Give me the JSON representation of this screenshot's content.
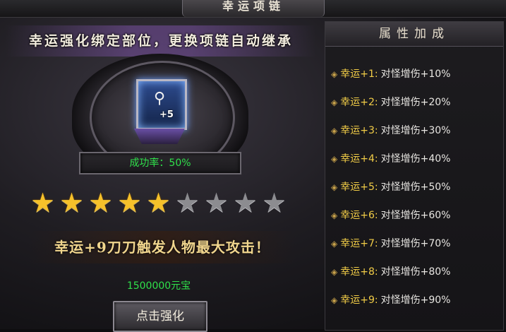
{
  "window": {
    "title": "幸运项链"
  },
  "banner": "幸运强化绑定部位，更换项链自动继承",
  "item": {
    "icon": "necklace-icon",
    "level_badge": "+5"
  },
  "success_rate": "成功率：50%",
  "stars": {
    "total": 9,
    "lit": 5
  },
  "tip": "幸运+9刀刀触发人物最大攻击！",
  "cost": "1500000元宝",
  "button": {
    "label": "点击强化"
  },
  "attributes": {
    "title": "属性加成",
    "items": [
      {
        "level": "幸运+1:",
        "bonus": "对怪增伤+10%"
      },
      {
        "level": "幸运+2:",
        "bonus": "对怪增伤+20%"
      },
      {
        "level": "幸运+3:",
        "bonus": "对怪增伤+30%"
      },
      {
        "level": "幸运+4:",
        "bonus": "对怪增伤+40%"
      },
      {
        "level": "幸运+5:",
        "bonus": "对怪增伤+50%"
      },
      {
        "level": "幸运+6:",
        "bonus": "对怪增伤+60%"
      },
      {
        "level": "幸运+7:",
        "bonus": "对怪增伤+70%"
      },
      {
        "level": "幸运+8:",
        "bonus": "对怪增伤+80%"
      },
      {
        "level": "幸运+9:",
        "bonus": "对怪增伤+90%"
      }
    ]
  },
  "colors": {
    "success": "#2fe04a",
    "star_on": "#f6c12a",
    "star_off": "#8c8c90",
    "level_text": "#f2cd47",
    "tip_text": "#f1d68e"
  }
}
